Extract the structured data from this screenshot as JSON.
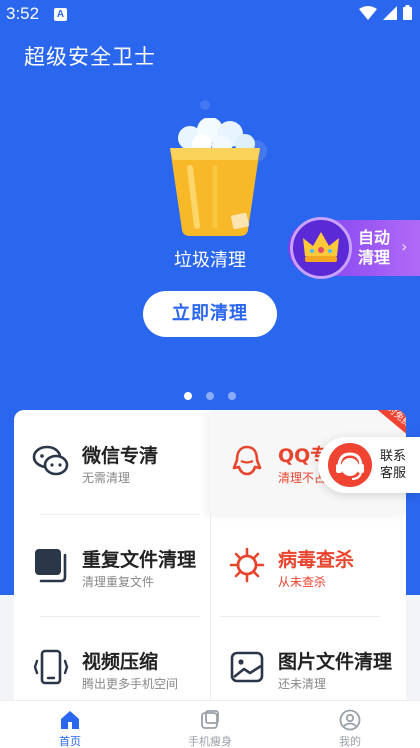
{
  "status_bar": {
    "time": "3:52",
    "notif": "A"
  },
  "app": {
    "title": "超级安全卫士"
  },
  "hero": {
    "bin_label": "垃圾清理",
    "clean_button": "立即清理",
    "auto_clean": {
      "line1": "自动",
      "line2": "清理"
    },
    "pager": {
      "count": 3,
      "active": 1
    }
  },
  "features": [
    {
      "title": "微信专清",
      "subtitle": "无需清理",
      "icon": "wechat-icon"
    },
    {
      "title": "QQ专清",
      "subtitle": "清理不占内存",
      "icon": "qq-icon",
      "badge": "限时免费"
    },
    {
      "title": "重复文件清理",
      "subtitle": "清理重复文件",
      "icon": "duplicate-files-icon"
    },
    {
      "title": "病毒查杀",
      "subtitle": "从未查杀",
      "icon": "virus-icon"
    },
    {
      "title": "视频压缩",
      "subtitle": "腾出更多手机空间",
      "icon": "video-compress-icon"
    },
    {
      "title": "图片文件清理",
      "subtitle": "还未清理",
      "icon": "image-files-icon"
    }
  ],
  "customer_service": {
    "line1": "联系",
    "line2": "客服"
  },
  "tabs": [
    {
      "label": "首页",
      "icon": "home-icon",
      "active": true
    },
    {
      "label": "手机瘦身",
      "icon": "phone-slim-icon",
      "active": false
    },
    {
      "label": "我的",
      "icon": "profile-icon",
      "active": false
    }
  ],
  "colors": {
    "brand_blue": "#2a66ee",
    "alert_red": "#e8452f"
  }
}
